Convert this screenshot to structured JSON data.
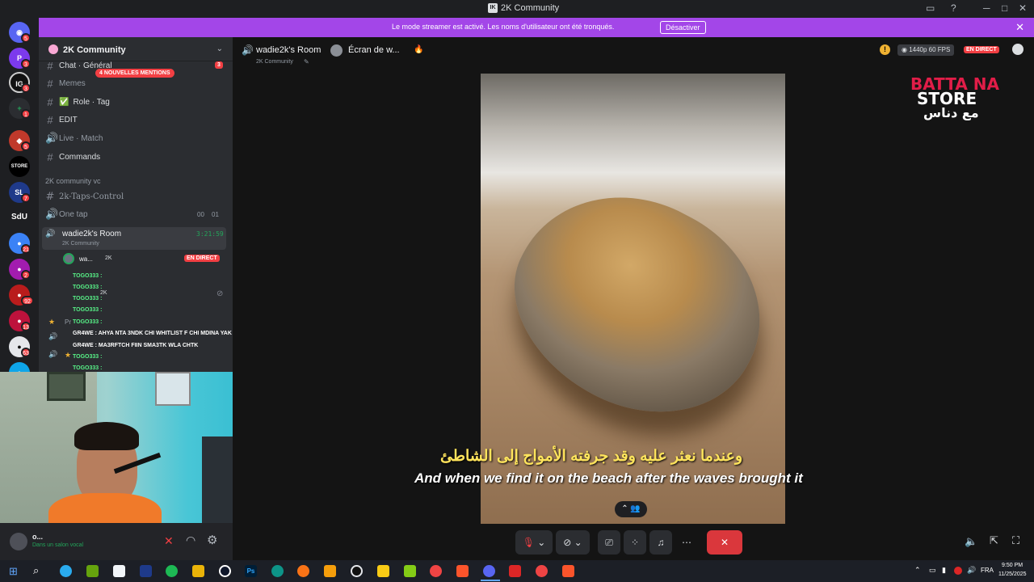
{
  "window": {
    "title": "2K Community"
  },
  "banner": {
    "message": "Le mode streamer est activé. Les noms d'utilisateur ont été tronqués.",
    "button": "Désactiver"
  },
  "guild_badges": [
    "5",
    "3",
    "3",
    "1",
    "5",
    "7",
    "21",
    "2",
    "92",
    "13",
    "63"
  ],
  "guild_label": "SdU",
  "server": {
    "name": "2K Community"
  },
  "channels": {
    "chat_general": "Chat · Général",
    "chat_badge": "3",
    "mention_pill": "4 NOUVELLES MENTIONS",
    "memes": "Memes",
    "role_tag": "Role · Tag",
    "edit": "EDIT",
    "live_match": "Live · Match",
    "commands": "Commands",
    "voice_category": "2K community vc",
    "taps_control": "2k-Taps-Control",
    "one_tap": "One tap",
    "one_tap_a": "00",
    "one_tap_b": "01",
    "room_name": "wadie2k's Room",
    "room_sub": "2K Community",
    "room_time": "3:21:59",
    "member_name": "wa...",
    "member_tag": "2K",
    "live_label": "EN DIRECT",
    "member2_tag": "2K",
    "pr_label": "Pr"
  },
  "chat_overlay": [
    "TOGO333 :",
    "TOGO333 :",
    "TOGO333 :",
    "TOGO333 :",
    "TOGO333 :",
    "GR4WE : AHYA NTA 3NDK CHI WHITLIST F CHI MDINA YAK ??",
    "GR4WE : MA3RFTCH FIIN SMA3TK WLA CHTK",
    "TOGO333 :",
    "TOGO333 :"
  ],
  "userbar": {
    "name": "o...",
    "status": "Dans un salon vocal"
  },
  "stage": {
    "room_title": "wadie2k's Room",
    "server": "2K Community",
    "screen_label": "Écran de w...",
    "quality": "1440p 60 FPS",
    "live": "EN DIRECT"
  },
  "subtitles": {
    "arabic": "وعندما نعثر عليه وقد جرفته الأمواج إلى الشاطئ",
    "english": "And when we find it on the beach after the waves brought it"
  },
  "watermark": {
    "line1": "BATTA NA",
    "line2": "STORE",
    "line3": "مع دناس"
  },
  "taskbar": {
    "lang": "FRA",
    "time": "9:50 PM",
    "date": "11/25/2025"
  },
  "colors": {
    "accent": "#a346e8",
    "danger": "#f23f43",
    "online": "#23a55a",
    "subtitle_yellow": "#ffe45c"
  }
}
